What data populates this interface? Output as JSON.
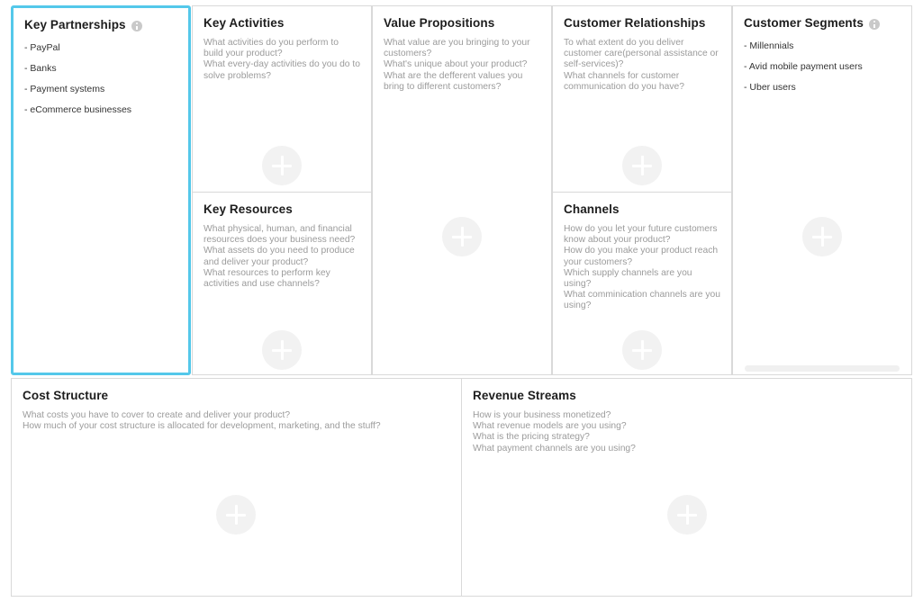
{
  "theme": {
    "selected_border": "#54c8ea",
    "panel_border": "#d9d9d9",
    "hint_text": "#9b9b9b",
    "entry_text": "#333333",
    "title_text": "#1d1d1d",
    "add_button_bg": "#f2f2f2",
    "scroll_thumb": "#6ecdea"
  },
  "panels": {
    "key_partnerships": {
      "title": "Key Partnerships",
      "has_info_icon": true,
      "selected": true,
      "entries": [
        "- PayPal",
        "- Banks",
        "- Payment systems",
        "- eCommerce businesses"
      ],
      "add_label": "plus-icon"
    },
    "key_activities": {
      "title": "Key Activities",
      "has_info_icon": false,
      "selected": false,
      "hints": [
        "What activities do you perform to build your product?",
        "What every-day activities do you do to solve problems?"
      ],
      "add_label": "plus-icon"
    },
    "key_resources": {
      "title": "Key Resources",
      "has_info_icon": false,
      "selected": false,
      "hints": [
        "What physical, human, and financial resources does your business need?",
        "What assets do you need to produce and deliver your product?",
        "What resources to perform key activities and use channels?"
      ],
      "add_label": "plus-icon"
    },
    "value_propositions": {
      "title": "Value Propositions",
      "has_info_icon": false,
      "selected": false,
      "hints": [
        "What value are you bringing to your customers?",
        "What's unique about your product?",
        "What are the defferent values you bring to different customers?"
      ],
      "add_label": "plus-icon"
    },
    "customer_relationships": {
      "title": "Customer Relationships",
      "has_info_icon": false,
      "selected": false,
      "hints": [
        "To what extent do you deliver customer care(personal assistance or self-services)?",
        "What channels for customer communication do you have?"
      ],
      "add_label": "plus-icon"
    },
    "channels": {
      "title": "Channels",
      "has_info_icon": false,
      "selected": false,
      "hints": [
        "How do you let your future customers know about your product?",
        "How do you make your product reach your customers?",
        "Which supply channels are you using?",
        "What comminication channels are you using?"
      ],
      "add_label": "plus-icon"
    },
    "customer_segments": {
      "title": "Customer Segments",
      "has_info_icon": true,
      "selected": false,
      "entries": [
        "- Millennials",
        "- Avid mobile payment users",
        "- Uber users"
      ],
      "add_label": "plus-icon"
    },
    "cost_structure": {
      "title": "Cost Structure",
      "has_info_icon": false,
      "selected": false,
      "hints": [
        "What costs you have to cover to create and deliver your product?",
        "How much of your cost structure is allocated for development, marketing, and the stuff?"
      ],
      "add_label": "plus-icon"
    },
    "revenue_streams": {
      "title": "Revenue Streams",
      "has_info_icon": false,
      "selected": false,
      "hints": [
        "How is your business monetized?",
        "What revenue models are you using?",
        "What is the pricing strategy?",
        "What payment channels are you using?"
      ],
      "add_label": "plus-icon"
    }
  }
}
